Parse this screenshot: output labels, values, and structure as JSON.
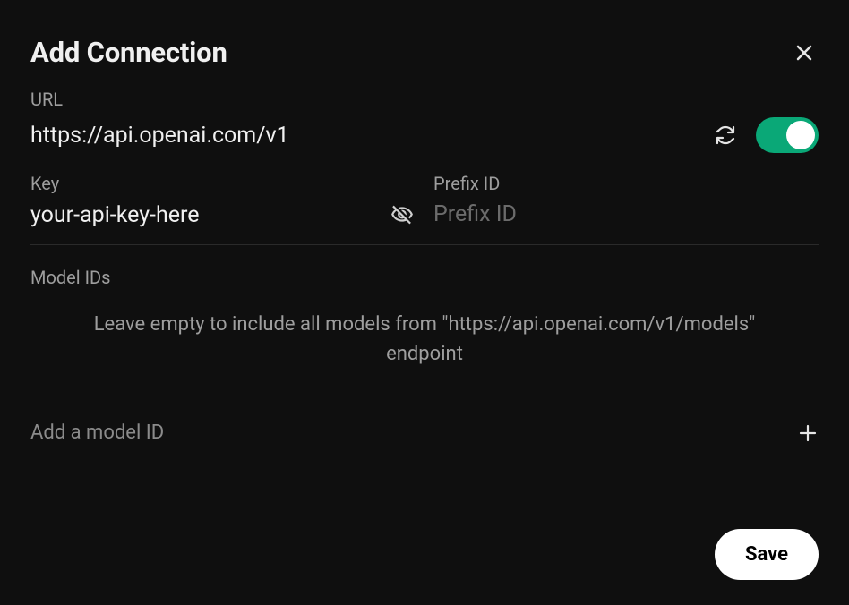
{
  "header": {
    "title": "Add Connection"
  },
  "url_field": {
    "label": "URL",
    "value": "https://api.openai.com/v1"
  },
  "toggle": {
    "on": true,
    "accent": "#0aa877"
  },
  "key_field": {
    "label": "Key",
    "value": "your-api-key-here"
  },
  "prefix_field": {
    "label": "Prefix ID",
    "placeholder": "Prefix ID",
    "value": ""
  },
  "model_ids": {
    "label": "Model IDs",
    "helper": "Leave empty to include all models from \"https://api.openai.com/v1/models\" endpoint",
    "add_placeholder": "Add a model ID"
  },
  "footer": {
    "save_label": "Save"
  }
}
